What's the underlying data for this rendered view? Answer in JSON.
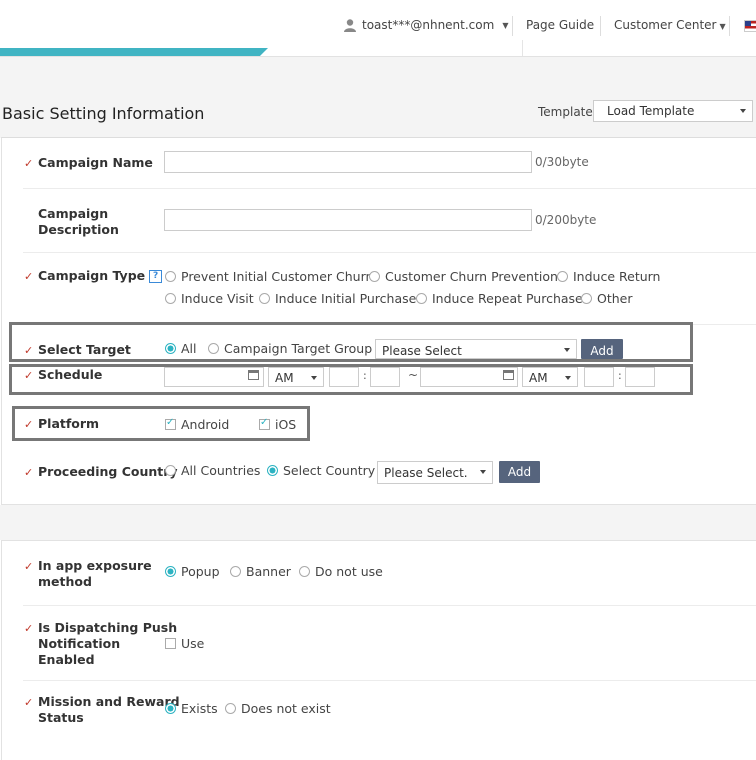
{
  "header": {
    "user_email": "toast***@nhnent.com",
    "page_guide": "Page Guide",
    "customer_center": "Customer Center"
  },
  "section": {
    "title": "Basic Setting Information",
    "template_label": "Template",
    "template_value": "Load Template"
  },
  "form": {
    "campaign_name": {
      "label": "Campaign Name",
      "value": "",
      "hint": "0/30byte"
    },
    "campaign_description": {
      "label_line1": "Campaign",
      "label_line2": "Description",
      "value": "",
      "hint": "0/200byte"
    },
    "campaign_type": {
      "label": "Campaign Type",
      "help": "?",
      "options": [
        "Prevent Initial Customer Churn",
        "Customer Churn Prevention",
        "Induce Return",
        "Induce Visit",
        "Induce Initial Purchase",
        "Induce Repeat Purchase",
        "Other"
      ]
    },
    "select_target": {
      "label": "Select Target",
      "options": [
        "All",
        "Campaign Target Group"
      ],
      "selected": "All",
      "group_select": "Please Select",
      "add": "Add"
    },
    "schedule": {
      "label": "Schedule",
      "start_ampm": "AM",
      "end_ampm": "AM",
      "separator": "~",
      "colon": ":"
    },
    "platform": {
      "label": "Platform",
      "android": "Android",
      "ios": "iOS"
    },
    "country": {
      "label": "Proceeding Country",
      "options": [
        "All Countries",
        "Select Country"
      ],
      "selected": "Select Country",
      "select": "Please Select.",
      "add": "Add"
    },
    "exposure": {
      "label_line1": "In app exposure",
      "label_line2": "method",
      "options": [
        "Popup",
        "Banner",
        "Do not use"
      ],
      "selected": "Popup"
    },
    "push": {
      "label_line1": "Is Dispatching Push",
      "label_line2": "Notification",
      "label_line3": "Enabled",
      "use": "Use"
    },
    "mission": {
      "label_line1": "Mission and Reward",
      "label_line2": "Status",
      "options": [
        "Exists",
        "Does not exist"
      ],
      "selected": "Exists"
    }
  },
  "colors": {
    "accent": "#2cb3c2",
    "progress": "#40b4c3",
    "button": "#56647d",
    "required": "#c0392b",
    "highlight": "#777777"
  },
  "icons": [
    "user-icon",
    "caret-down-icon",
    "us-flag-icon",
    "help-icon",
    "calendar-icon",
    "checkmark-icon"
  ]
}
